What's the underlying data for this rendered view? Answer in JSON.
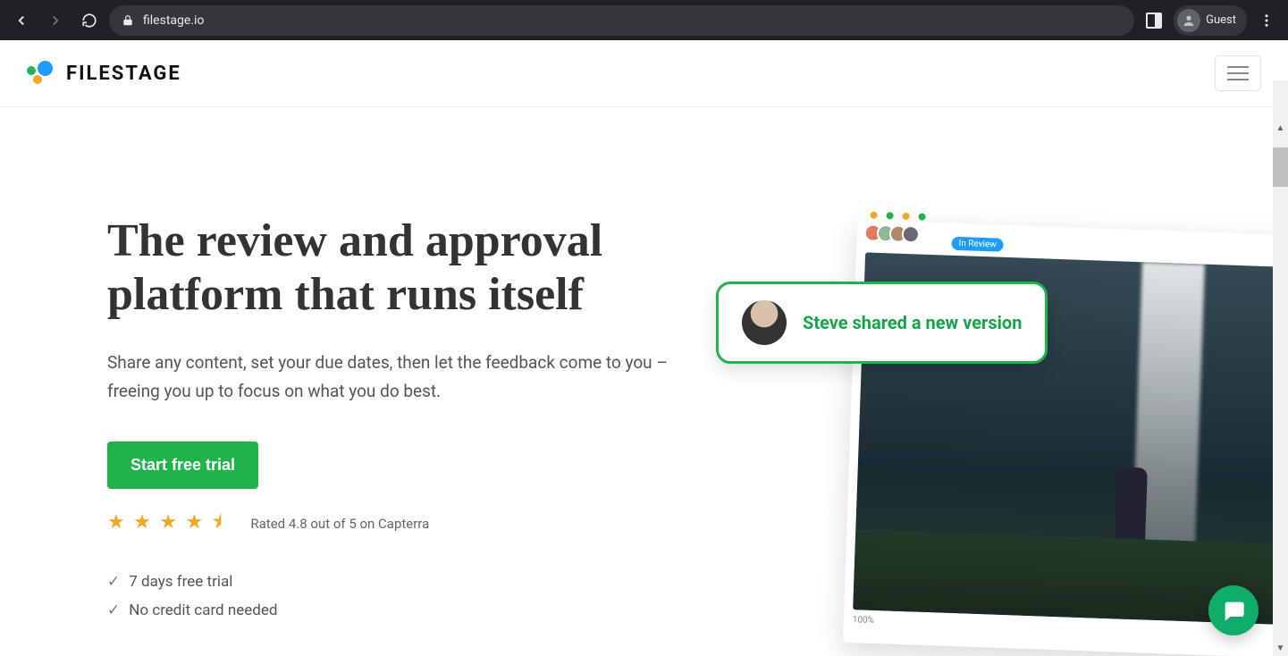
{
  "browser": {
    "url": "filestage.io",
    "profile": "Guest"
  },
  "header": {
    "brand": "FILESTAGE"
  },
  "hero": {
    "heading": "The review and approval platform that runs itself",
    "subheading": "Share any content, set your due dates, then let the feedback come to you – freeing you up to focus on what you do best.",
    "cta_label": "Start free trial",
    "rating_text": "Rated 4.8 out of 5 on Capterra",
    "rating_stars": 4.8,
    "checks": [
      "7 days free trial",
      "No credit card needed"
    ]
  },
  "illustration": {
    "status_badge": "In Review",
    "toast": "Steve shared a new version",
    "zoom_label": "100%"
  },
  "colors": {
    "brand_green": "#22b24c",
    "accent_orange": "#f5a623",
    "accent_blue": "#1e9cff"
  }
}
